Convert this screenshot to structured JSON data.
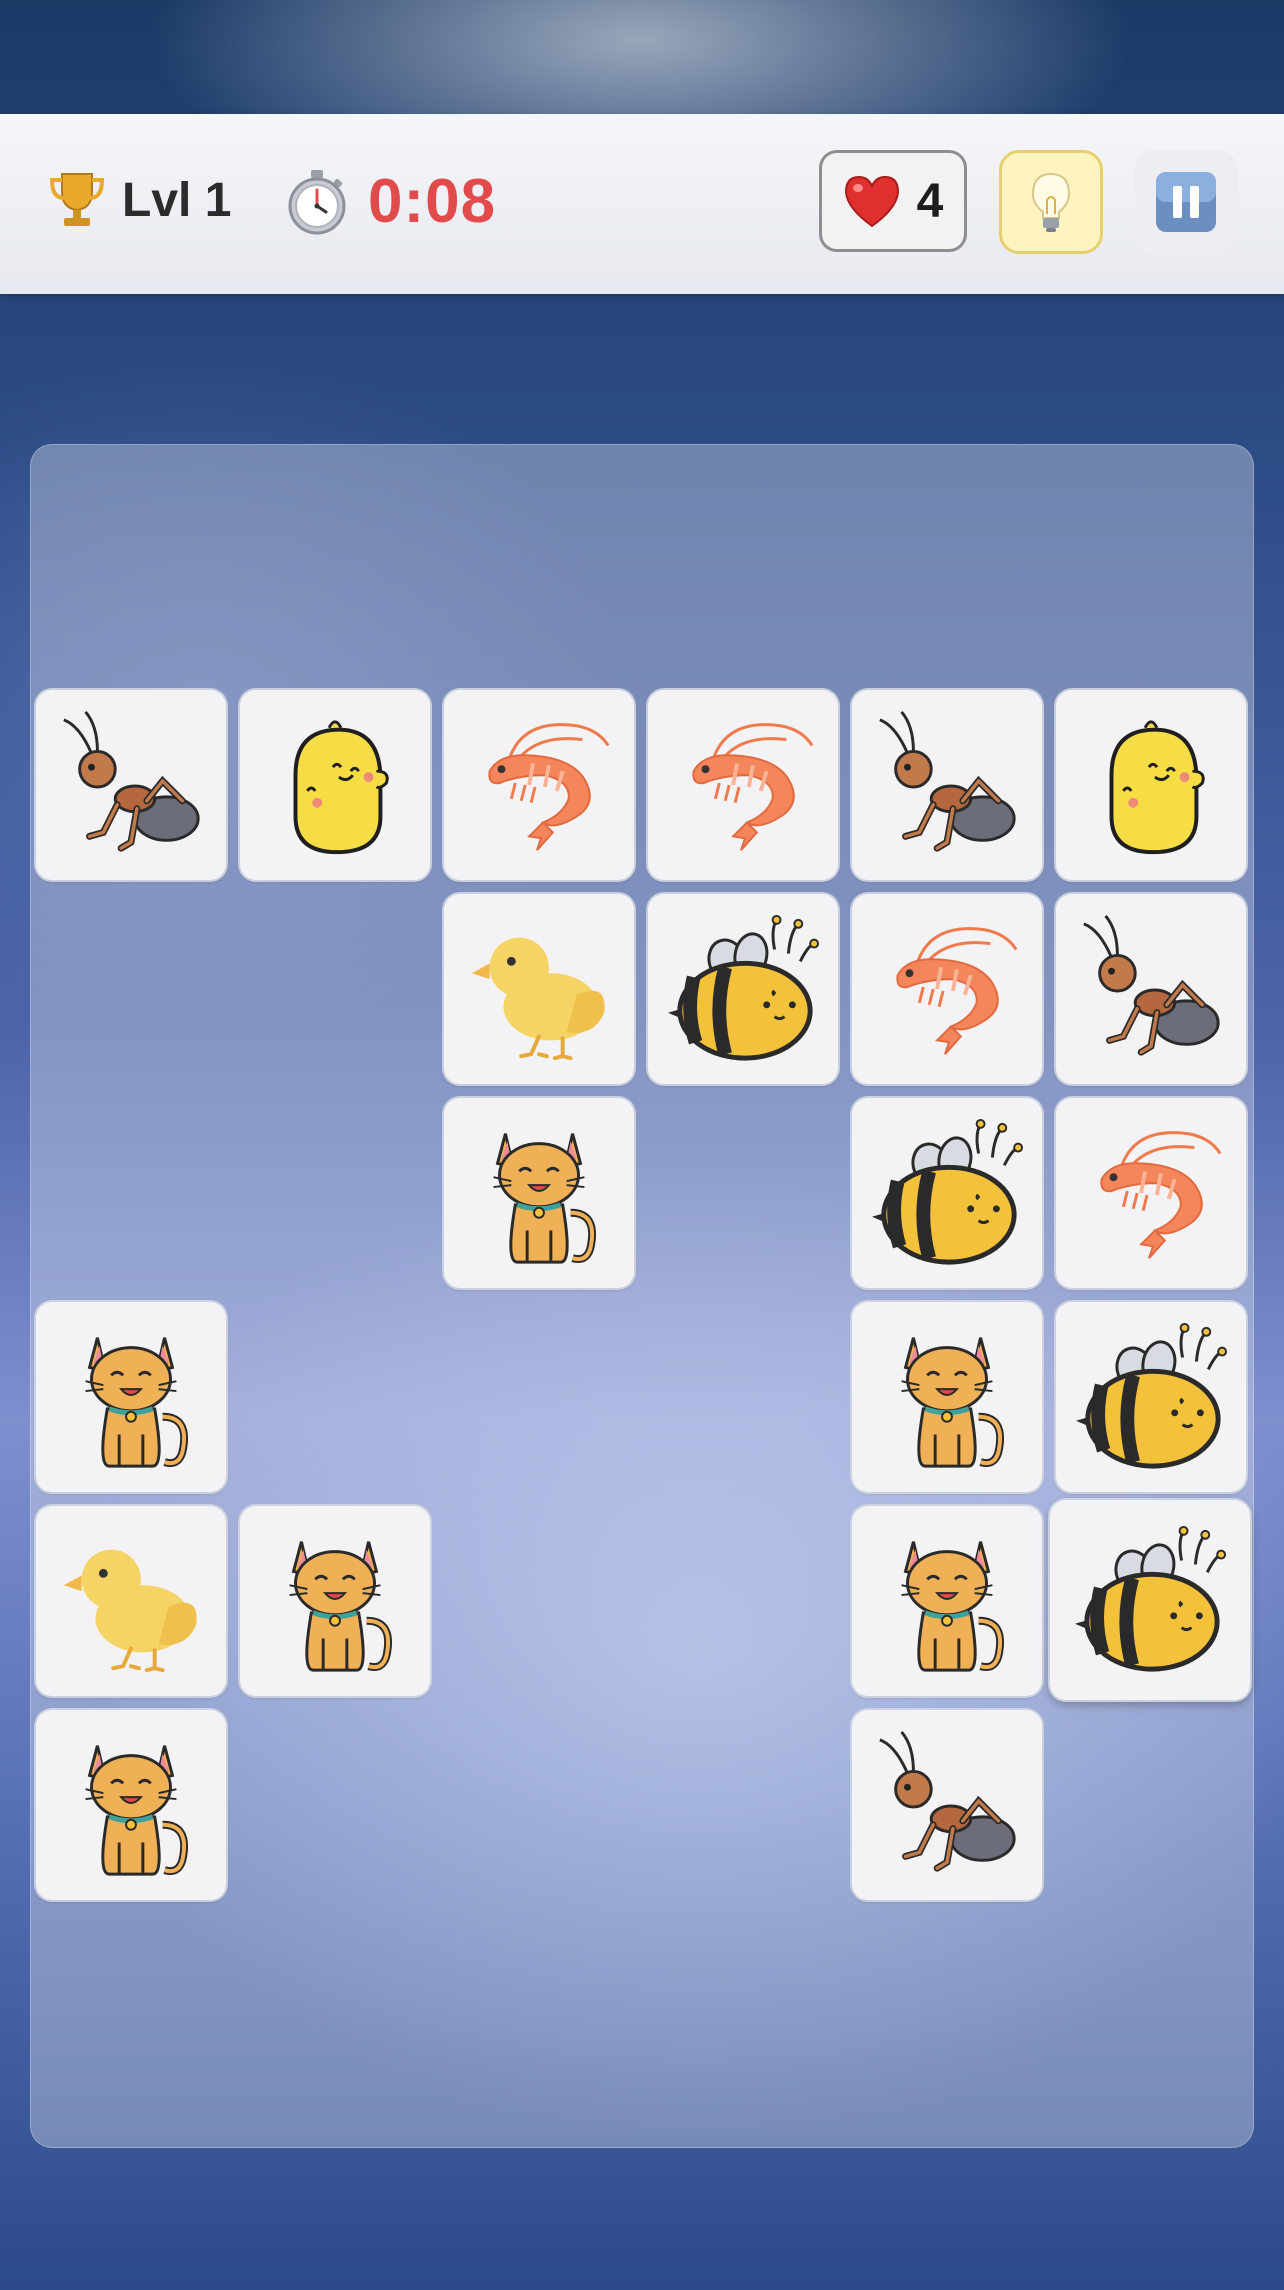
{
  "header": {
    "level_label": "Lvl 1",
    "timer": "0:08",
    "lives": "4",
    "timer_color": "#e24b4b"
  },
  "icons": {
    "level": "trophy-icon",
    "timer": "stopwatch-icon",
    "lives": "heart-icon",
    "hint": "lightbulb-icon",
    "pause": "pause-icon"
  },
  "board": {
    "tiles": [
      {
        "row": 0,
        "col": 0,
        "kind": "ant"
      },
      {
        "row": 0,
        "col": 1,
        "kind": "chick-round"
      },
      {
        "row": 0,
        "col": 2,
        "kind": "shrimp"
      },
      {
        "row": 0,
        "col": 3,
        "kind": "shrimp"
      },
      {
        "row": 0,
        "col": 4,
        "kind": "ant"
      },
      {
        "row": 0,
        "col": 5,
        "kind": "chick-round"
      },
      {
        "row": 1,
        "col": 2,
        "kind": "duckling"
      },
      {
        "row": 1,
        "col": 3,
        "kind": "bee"
      },
      {
        "row": 1,
        "col": 4,
        "kind": "shrimp"
      },
      {
        "row": 1,
        "col": 5,
        "kind": "ant"
      },
      {
        "row": 2,
        "col": 2,
        "kind": "cat"
      },
      {
        "row": 2,
        "col": 4,
        "kind": "bee"
      },
      {
        "row": 2,
        "col": 5,
        "kind": "shrimp"
      },
      {
        "row": 3,
        "col": 0,
        "kind": "cat"
      },
      {
        "row": 3,
        "col": 4,
        "kind": "cat"
      },
      {
        "row": 3,
        "col": 5,
        "kind": "bee"
      },
      {
        "row": 4,
        "col": 0,
        "kind": "duckling"
      },
      {
        "row": 4,
        "col": 1,
        "kind": "cat"
      },
      {
        "row": 4,
        "col": 4,
        "kind": "cat"
      },
      {
        "row": 4,
        "col": 5,
        "kind": "bee",
        "selected": true
      },
      {
        "row": 5,
        "col": 0,
        "kind": "cat"
      },
      {
        "row": 5,
        "col": 4,
        "kind": "ant"
      }
    ]
  }
}
